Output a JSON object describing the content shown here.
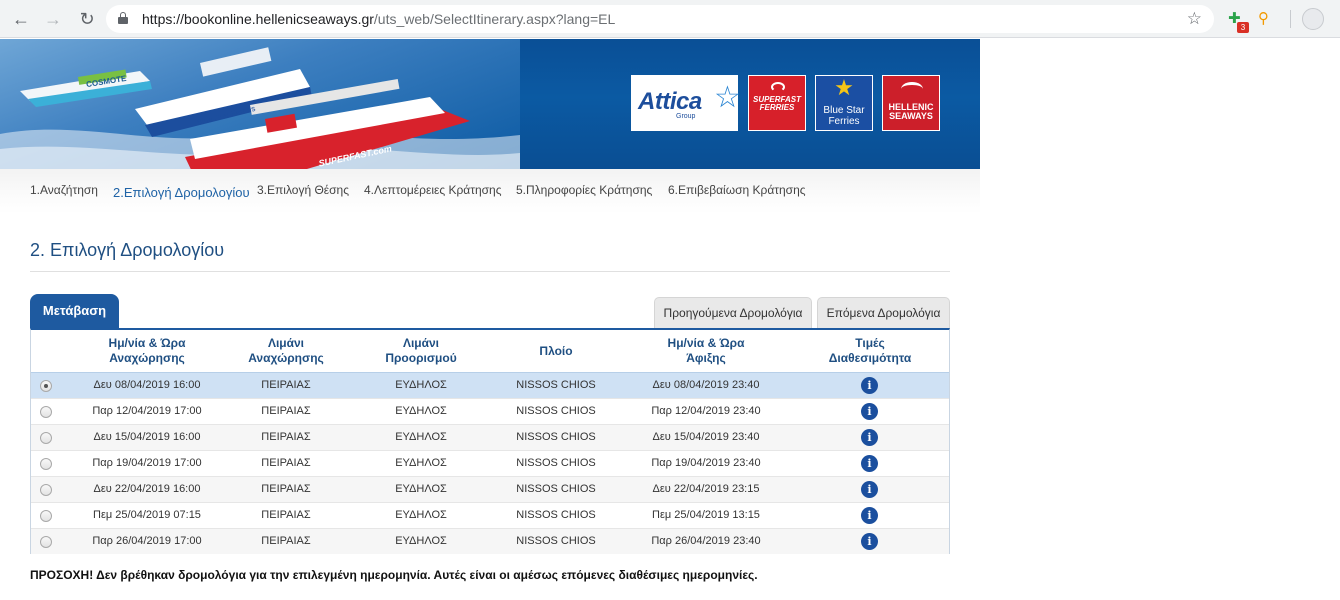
{
  "browser": {
    "url_host": "https://bookonline.hellenicseaways.gr",
    "url_path": "/uts_web/SelectItinerary.aspx?lang=EL",
    "ext_badge": "3"
  },
  "banner": {
    "attica_name": "Attica",
    "attica_sub": "Group",
    "superfast": "SUPERFAST FERRIES",
    "bluestar": "Blue Star Ferries",
    "hellenic": "HELLENIC SEAWAYS",
    "ship1_label": "COSMOTE",
    "ship2_label": "Blue Star Ferries",
    "ship3_label": "SUPERFAST.com"
  },
  "steps": [
    "1.Αναζήτηση",
    "2.Επιλογή Δρομολογίου",
    "3.Επιλογή Θέσης",
    "4.Λεπτομέρειες Κράτησης",
    "5.Πληροφορίες Κράτησης",
    "6.Επιβεβαίωση Κράτησης"
  ],
  "page_title": "2. Επιλογή Δρομολογίου",
  "tabs": {
    "main": "Μετάβαση",
    "prev": "Προηγούμενα Δρομολόγια",
    "next": "Επόμενα Δρομολόγια"
  },
  "table": {
    "headers": {
      "departure_line1": "Ημ/νία & Ώρα",
      "departure_line2": "Αναχώρησης",
      "from_line1": "Λιμάνι",
      "from_line2": "Αναχώρησης",
      "to_line1": "Λιμάνι",
      "to_line2": "Προορισμού",
      "vessel": "Πλοίο",
      "arrival_line1": "Ημ/νία & Ώρα",
      "arrival_line2": "Άφιξης",
      "prices_line1": "Τιμές",
      "prices_line2": "Διαθεσιμότητα"
    },
    "info_glyph": "i",
    "rows": [
      {
        "departure": "Δευ 08/04/2019 16:00",
        "from": "ΠΕΙΡΑΙΑΣ",
        "to": "ΕΥΔΗΛΟΣ",
        "vessel": "NISSOS CHIOS",
        "arrival": "Δευ 08/04/2019 23:40"
      },
      {
        "departure": "Παρ 12/04/2019 17:00",
        "from": "ΠΕΙΡΑΙΑΣ",
        "to": "ΕΥΔΗΛΟΣ",
        "vessel": "NISSOS CHIOS",
        "arrival": "Παρ 12/04/2019 23:40"
      },
      {
        "departure": "Δευ 15/04/2019 16:00",
        "from": "ΠΕΙΡΑΙΑΣ",
        "to": "ΕΥΔΗΛΟΣ",
        "vessel": "NISSOS CHIOS",
        "arrival": "Δευ 15/04/2019 23:40"
      },
      {
        "departure": "Παρ 19/04/2019 17:00",
        "from": "ΠΕΙΡΑΙΑΣ",
        "to": "ΕΥΔΗΛΟΣ",
        "vessel": "NISSOS CHIOS",
        "arrival": "Παρ 19/04/2019 23:40"
      },
      {
        "departure": "Δευ 22/04/2019 16:00",
        "from": "ΠΕΙΡΑΙΑΣ",
        "to": "ΕΥΔΗΛΟΣ",
        "vessel": "NISSOS CHIOS",
        "arrival": "Δευ 22/04/2019 23:15"
      },
      {
        "departure": "Πεμ 25/04/2019 07:15",
        "from": "ΠΕΙΡΑΙΑΣ",
        "to": "ΕΥΔΗΛΟΣ",
        "vessel": "NISSOS CHIOS",
        "arrival": "Πεμ 25/04/2019 13:15"
      },
      {
        "departure": "Παρ 26/04/2019 17:00",
        "from": "ΠΕΙΡΑΙΑΣ",
        "to": "ΕΥΔΗΛΟΣ",
        "vessel": "NISSOS CHIOS",
        "arrival": "Παρ 26/04/2019 23:40"
      }
    ]
  },
  "warning": "ΠΡΟΣΟΧΗ! Δεν βρέθηκαν δρομολόγια για την επιλεγμένη ημερομηνία. Αυτές είναι οι αμέσως επόμενες διαθέσιμες ημερομηνίες."
}
